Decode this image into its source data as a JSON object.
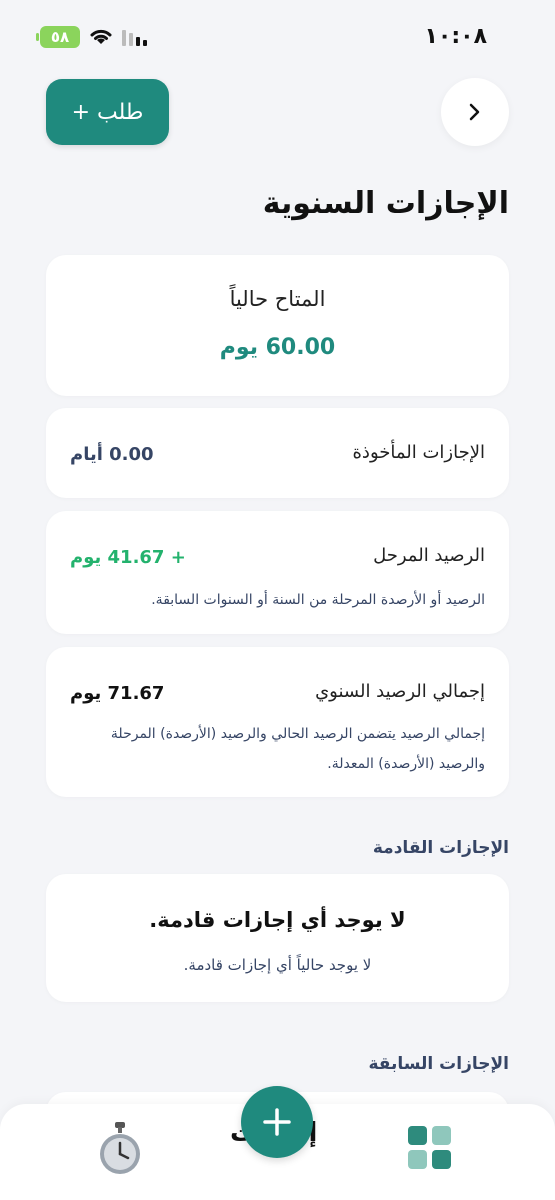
{
  "status_bar": {
    "time": "١٠:٠٨",
    "battery": "٥٨"
  },
  "header": {
    "request_button": "+ طلب",
    "title": "الإجازات السنوية"
  },
  "available": {
    "label": "المتاح حالياً",
    "value": "60.00 يوم"
  },
  "taken": {
    "label": "الإجازات المأخوذة",
    "value": "0.00 أيام"
  },
  "carried": {
    "label": "الرصيد المرحل",
    "value": "+ 41.67 يوم",
    "description": "الرصيد أو الأرصدة المرحلة من السنة أو السنوات السابقة."
  },
  "total": {
    "label": "إجمالي الرصيد السنوي",
    "value": "71.67 يوم",
    "description": "إجمالي الرصيد يتضمن الرصيد الحالي والرصيد (الأرصدة) المرحلة والرصيد (الأرصدة) المعدلة."
  },
  "upcoming": {
    "section_title": "الإجازات القادمة",
    "empty_title": "لا يوجد أي إجازات قادمة.",
    "empty_subtitle": "لا يوجد حالياً أي إجازات قادمة."
  },
  "past": {
    "section_title": "الإجازات السابقة"
  },
  "bottom_nav": {
    "partial_label": "إجازات"
  },
  "colors": {
    "primary": "#1f8a7e",
    "positive": "#23b26d",
    "muted_text": "#364565",
    "background": "#f4f5f8"
  },
  "icons": [
    "battery-icon",
    "wifi-icon",
    "signal-icon",
    "chevron-right-icon",
    "plus-icon",
    "stopwatch-icon",
    "grid-icon"
  ]
}
